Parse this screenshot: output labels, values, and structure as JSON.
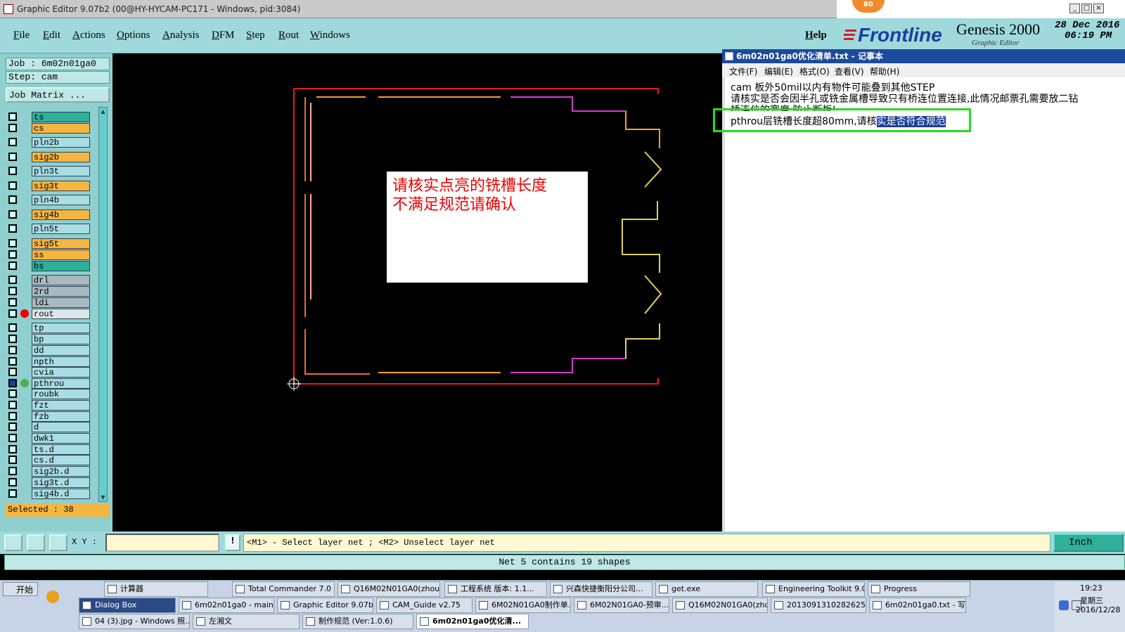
{
  "window": {
    "title": "Graphic Editor 9.07b2 (00@HY-HYCAM-PC171 - Windows, pid:3084)",
    "badge": "80",
    "controls": [
      "_",
      "□",
      "×"
    ]
  },
  "menu": [
    "File",
    "Edit",
    "Actions",
    "Options",
    "Analysis",
    "DFM",
    "Step",
    "Rout",
    "Windows"
  ],
  "help": "Help",
  "brand": {
    "frontline": "Frontline",
    "genesis": "Genesis 2000",
    "subtitle": "Graphic Editor",
    "date": "28 Dec 2016",
    "time": "06:19 PM"
  },
  "job": {
    "job_label": "Job : 6m02n01ga0",
    "step_label": "Step: cam",
    "matrix_button": "Job Matrix ..."
  },
  "layers": [
    {
      "name": "ts",
      "color": "#2eb09a"
    },
    {
      "name": "cs",
      "color": "#f5b541"
    },
    {
      "name": "pln2b",
      "color": "#a8dde4"
    },
    {
      "name": "sig2b",
      "color": "#f5b541"
    },
    {
      "name": "pln3t",
      "color": "#a8dde4"
    },
    {
      "name": "sig3t",
      "color": "#f5b541"
    },
    {
      "name": "pln4b",
      "color": "#a8dde4"
    },
    {
      "name": "sig4b",
      "color": "#f5b541"
    },
    {
      "name": "pln5t",
      "color": "#a8dde4"
    },
    {
      "name": "sig5t",
      "color": "#f5b541"
    },
    {
      "name": "ss",
      "color": "#f5b541"
    },
    {
      "name": "bs",
      "color": "#2eb09a"
    },
    {
      "name": "drl",
      "color": "#a9b9c0"
    },
    {
      "name": "2rd",
      "color": "#a9b9c0"
    },
    {
      "name": "ldi",
      "color": "#a9b9c0"
    },
    {
      "name": "rout",
      "color": "#dce8e8"
    },
    {
      "name": "tp",
      "color": "#a8dde4"
    },
    {
      "name": "bp",
      "color": "#a8dde4"
    },
    {
      "name": "dd",
      "color": "#a8dde4"
    },
    {
      "name": "npth",
      "color": "#a8dde4"
    },
    {
      "name": "cvia",
      "color": "#a8dde4"
    },
    {
      "name": "pthrou",
      "color": "#a8dde4"
    },
    {
      "name": "roubk",
      "color": "#a8dde4"
    },
    {
      "name": "fzt",
      "color": "#a8dde4"
    },
    {
      "name": "fzb",
      "color": "#a8dde4"
    },
    {
      "name": "d",
      "color": "#a8dde4"
    },
    {
      "name": "dwk1",
      "color": "#a8dde4"
    },
    {
      "name": "ts.d",
      "color": "#a8dde4"
    },
    {
      "name": "cs.d",
      "color": "#a8dde4"
    },
    {
      "name": "sig2b.d",
      "color": "#a8dde4"
    },
    {
      "name": "sig3t.d",
      "color": "#a8dde4"
    },
    {
      "name": "sig4b.d",
      "color": "#a8dde4"
    }
  ],
  "selected": "Selected : 38",
  "canvas_note": {
    "line1": "请核实点亮的铣槽长度",
    "line2": "不满足规范请确认"
  },
  "notepad": {
    "title": "6m02n01ga0优化清单.txt - 记事本",
    "menu": [
      "文件(F)",
      "编辑(E)",
      "格式(O)",
      "查看(V)",
      "帮助(H)"
    ],
    "line1": "cam 板外50mil以内有物件可能叠到其他STEP",
    "line2": "请核实是否会因半孔或铣金属槽导致只有桥连位置连接,此情况邮票孔需要放二钻",
    "line3": "桥连位的宽度,防止断板!",
    "line4_plain": "pthrou层铣槽长度超80mm,请核",
    "line4_selected": "实是否符合规范"
  },
  "cmdbar": {
    "xy_label": "X Y :",
    "xy_value": "",
    "hint": "<M1> - Select layer net ; <M2> Unselect layer net",
    "unit": "Inch"
  },
  "status": "Net 5 contains 19 shapes",
  "taskbar": {
    "start": "开始",
    "row1": [
      "计算器",
      "Total Commander 7.0 p...",
      "Q16M02N01GA0(zhoub...",
      "工程系统  版本: 1.1...",
      "兴森快捷衡阳分公司...",
      "get.exe",
      "Engineering Toolkit 9.0...",
      "Progress"
    ],
    "row2": [
      "Dialog Box",
      "6m02n01ga0 - main_qa",
      "Graphic Editor 9.07b...",
      "CAM_Guide v2.75",
      "6M02N01GA0制作单...",
      "6M02N01GA0-预审...",
      "Q16M02N01GA0(zho...",
      "20130913102826250...",
      "6m02n01ga0.txt - 写..."
    ],
    "row3": [
      "04 (3).jpg - Windows 照...",
      "左湘文",
      "制作规范 (Ver:1.0.6)",
      "6m02n01ga0优化清..."
    ],
    "clock": "19:23",
    "weekday": "星期三",
    "date": "2016/12/28"
  }
}
